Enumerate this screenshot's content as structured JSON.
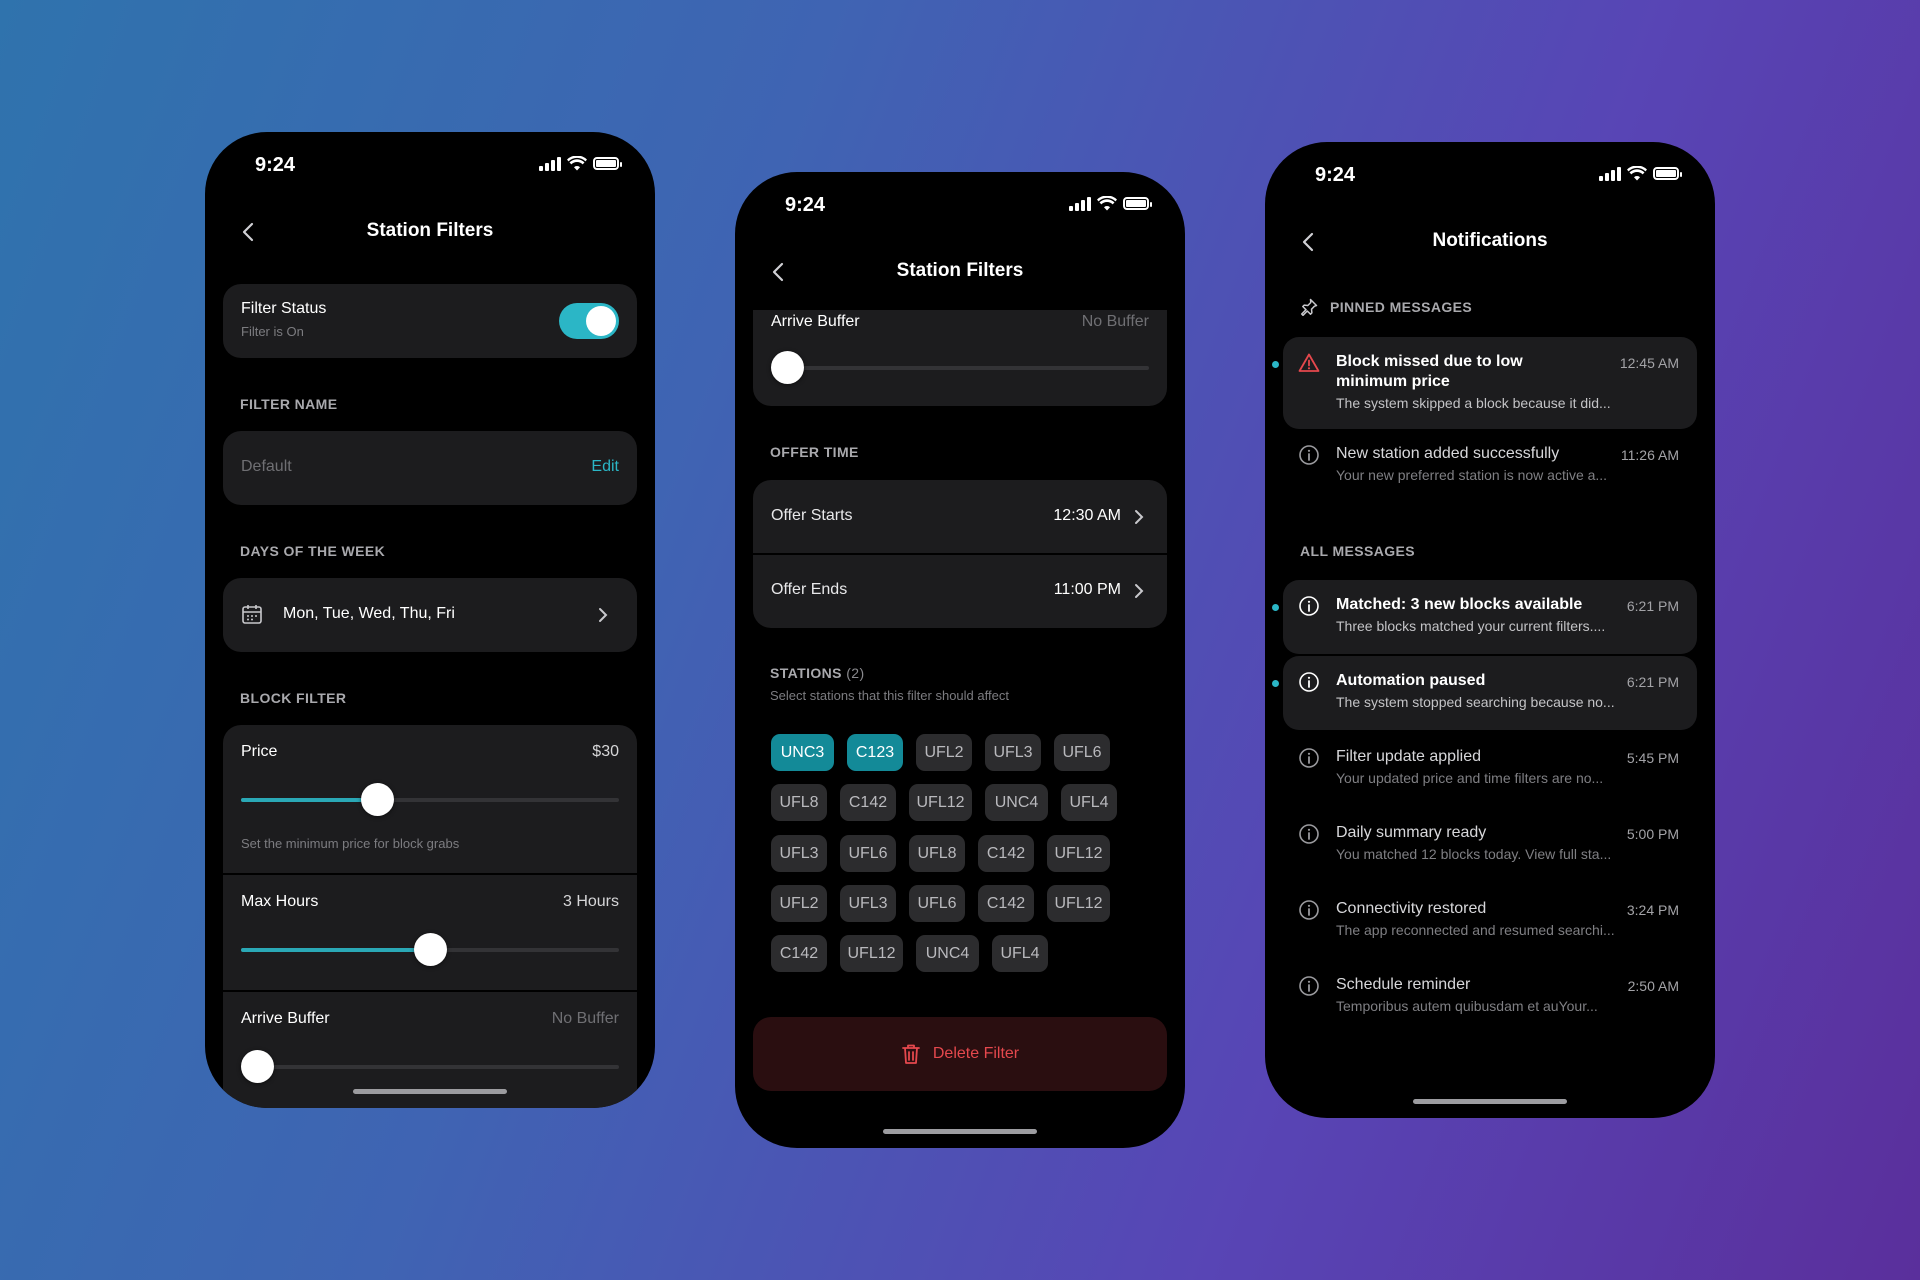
{
  "status": {
    "time": "9:24"
  },
  "screen1": {
    "title": "Station Filters",
    "filter_status": {
      "label": "Filter Status",
      "sub": "Filter is On",
      "on": true
    },
    "filter_name": {
      "section": "FILTER NAME",
      "value": "Default",
      "edit": "Edit"
    },
    "days": {
      "section": "DAYS OF THE WEEK",
      "value": "Mon, Tue, Wed, Thu, Fri"
    },
    "block_filter": {
      "section": "BLOCK FILTER",
      "price": {
        "label": "Price",
        "value": "$30",
        "hint": "Set the minimum price for block grabs",
        "level": 0.36
      },
      "max_hours": {
        "label": "Max Hours",
        "value": "3 Hours",
        "level": 0.5
      },
      "arrive_buffer": {
        "label": "Arrive Buffer",
        "value": "No Buffer",
        "level": 0
      }
    }
  },
  "screen2": {
    "title": "Station Filters",
    "arrive_buffer": {
      "label": "Arrive Buffer",
      "value": "No Buffer",
      "level": 0
    },
    "offer_time": {
      "section": "OFFER TIME",
      "starts": {
        "label": "Offer Starts",
        "value": "12:30 AM"
      },
      "ends": {
        "label": "Offer Ends",
        "value": "11:00 PM"
      }
    },
    "stations": {
      "section": "STATIONS",
      "count": "(2)",
      "sub": "Select stations that this filter should affect",
      "rows": [
        [
          {
            "code": "UNC3",
            "selected": true
          },
          {
            "code": "C123",
            "selected": true
          },
          {
            "code": "UFL2"
          },
          {
            "code": "UFL3"
          },
          {
            "code": "UFL6"
          }
        ],
        [
          {
            "code": "UFL8"
          },
          {
            "code": "C142"
          },
          {
            "code": "UFL12"
          },
          {
            "code": "UNC4"
          },
          {
            "code": "UFL4"
          }
        ],
        [
          {
            "code": "UFL3"
          },
          {
            "code": "UFL6"
          },
          {
            "code": "UFL8"
          },
          {
            "code": "C142"
          },
          {
            "code": "UFL12"
          }
        ],
        [
          {
            "code": "UFL2"
          },
          {
            "code": "UFL3"
          },
          {
            "code": "UFL6"
          },
          {
            "code": "C142"
          },
          {
            "code": "UFL12"
          }
        ],
        [
          {
            "code": "C142"
          },
          {
            "code": "UFL12"
          },
          {
            "code": "UNC4"
          },
          {
            "code": "UFL4"
          }
        ]
      ]
    },
    "delete_label": "Delete Filter"
  },
  "screen3": {
    "title": "Notifications",
    "pinned_section": "PINNED MESSAGES",
    "all_section": "ALL MESSAGES",
    "pinned": [
      {
        "title": "Block missed due to low minimum price",
        "time": "12:45 AM",
        "body": "The system skipped a block because it did...",
        "icon": "warning-icon",
        "highlight": true,
        "unread": true
      },
      {
        "title": "New station added successfully",
        "time": "11:26 AM",
        "body": "Your new preferred station is now active a...",
        "icon": "info-icon",
        "highlight": false,
        "unread": false
      }
    ],
    "all": [
      {
        "title": "Matched: 3 new blocks available",
        "time": "6:21 PM",
        "body": "Three blocks matched your current filters....",
        "icon": "info-icon",
        "highlight": true,
        "unread": true
      },
      {
        "title": "Automation paused",
        "time": "6:21 PM",
        "body": "The system stopped searching because no...",
        "icon": "info-icon",
        "highlight": true,
        "unread": true
      },
      {
        "title": "Filter update applied",
        "time": "5:45 PM",
        "body": "Your updated price and time filters are no...",
        "icon": "info-icon",
        "highlight": false,
        "unread": false
      },
      {
        "title": "Daily summary ready",
        "time": "5:00 PM",
        "body": "You matched 12 blocks today. View full sta...",
        "icon": "info-icon",
        "highlight": false,
        "unread": false
      },
      {
        "title": "Connectivity restored",
        "time": "3:24 PM",
        "body": "The app reconnected and resumed searchi...",
        "icon": "info-icon",
        "highlight": false,
        "unread": false
      },
      {
        "title": "Schedule reminder",
        "time": "2:50 AM",
        "body": "Temporibus autem quibusdam et auYour...",
        "icon": "info-icon",
        "highlight": false,
        "unread": false
      }
    ]
  },
  "colors": {
    "accent": "#2bb6c6",
    "chip_selected": "#138a98",
    "danger": "#e5484d",
    "card": "#1c1c1e"
  }
}
